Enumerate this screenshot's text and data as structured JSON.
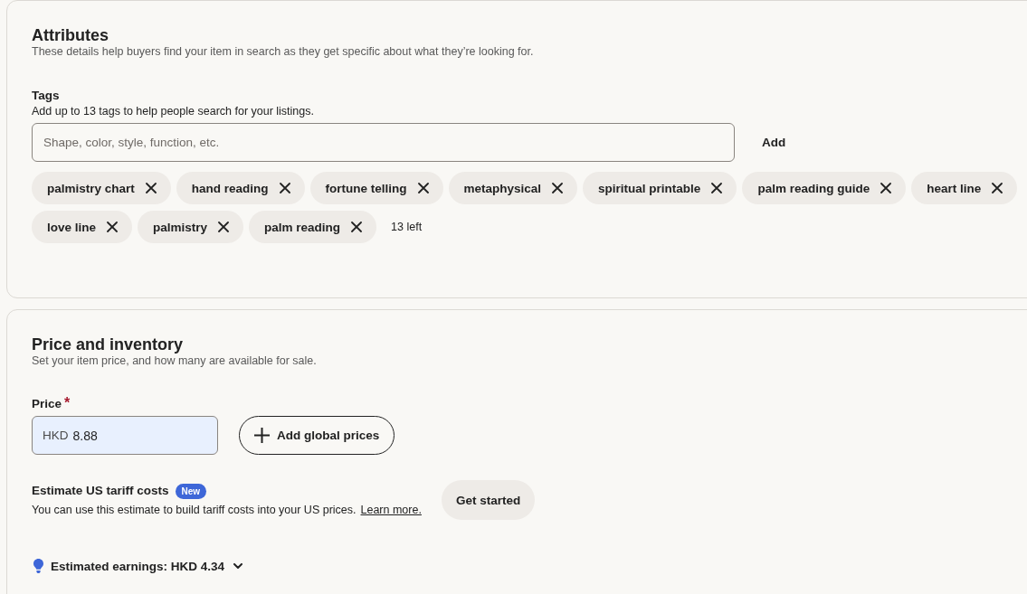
{
  "attributes": {
    "title": "Attributes",
    "subtitle": "These details help buyers find your item in search as they get specific about what they’re looking for.",
    "tags": {
      "label": "Tags",
      "hint": "Add up to 13 tags to help people search for your listings.",
      "input": {
        "placeholder": "Shape, color, style, function, etc."
      },
      "add_button": "Add",
      "items": [
        "palmistry chart",
        "hand reading",
        "fortune telling",
        "metaphysical",
        "spiritual printable",
        "palm reading guide",
        "heart line",
        "love line",
        "palmistry",
        "palm reading"
      ],
      "remaining": "13 left"
    }
  },
  "price_inventory": {
    "title": "Price and inventory",
    "subtitle": "Set your item price, and how many are available for sale.",
    "price": {
      "label": "Price",
      "required_mark": "*",
      "prefix": "HKD",
      "value": "8.88"
    },
    "global_prices_button": "Add global prices",
    "tariff": {
      "title": "Estimate US tariff costs",
      "badge": "New",
      "description": "You can use this estimate to build tariff costs into your US prices.",
      "link": "Learn more.",
      "button": "Get started"
    },
    "earnings": {
      "label": "Estimated earnings: HKD 4.34",
      "expanded": false
    }
  }
}
